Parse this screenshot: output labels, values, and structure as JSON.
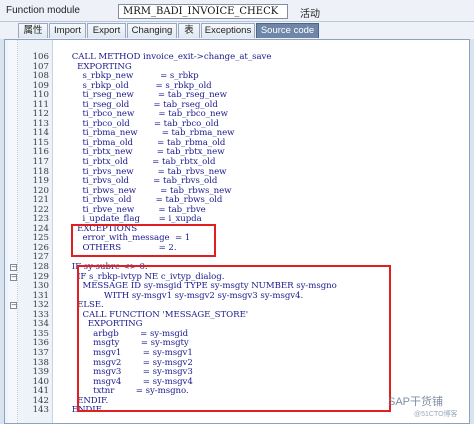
{
  "header": {
    "function_module_label": "Function module",
    "function_module_value": "MRM_BADI_INVOICE_CHECK",
    "status": "活动"
  },
  "tabs": [
    {
      "label": "属性"
    },
    {
      "label": "Import"
    },
    {
      "label": "Export"
    },
    {
      "label": "Changing"
    },
    {
      "label": "表"
    },
    {
      "label": "Exceptions"
    },
    {
      "label": "Source code",
      "active": true
    }
  ],
  "code": [
    {
      "n": "106",
      "t": "    CALL METHOD invoice_exit->change_at_save"
    },
    {
      "n": "107",
      "t": "      EXPORTING"
    },
    {
      "n": "108",
      "t": "        s_rbkp_new          = s_rbkp"
    },
    {
      "n": "109",
      "t": "        s_rbkp_old          = s_rbkp_old"
    },
    {
      "n": "110",
      "t": "        ti_rseg_new         = tab_rseg_new"
    },
    {
      "n": "111",
      "t": "        ti_rseg_old         = tab_rseg_old"
    },
    {
      "n": "112",
      "t": "        ti_rbco_new         = tab_rbco_new"
    },
    {
      "n": "113",
      "t": "        ti_rbco_old         = tab_rbco_old"
    },
    {
      "n": "114",
      "t": "        ti_rbma_new         = tab_rbma_new"
    },
    {
      "n": "115",
      "t": "        ti_rbma_old         = tab_rbma_old"
    },
    {
      "n": "116",
      "t": "        ti_rbtx_new         = tab_rbtx_new"
    },
    {
      "n": "117",
      "t": "        ti_rbtx_old         = tab_rbtx_old"
    },
    {
      "n": "118",
      "t": "        ti_rbvs_new         = tab_rbvs_new"
    },
    {
      "n": "119",
      "t": "        ti_rbvs_old         = tab_rbvs_old"
    },
    {
      "n": "120",
      "t": "        ti_rbws_new         = tab_rbws_new"
    },
    {
      "n": "121",
      "t": "        ti_rbws_old         = tab_rbws_old"
    },
    {
      "n": "122",
      "t": "        ti_rbve_new         = tab_rbve"
    },
    {
      "n": "123",
      "t": "        i_update_flag       = i_xupda"
    },
    {
      "n": "124",
      "t": "      EXCEPTIONS"
    },
    {
      "n": "125",
      "t": "        error_with_message  = 1"
    },
    {
      "n": "126",
      "t": "        OTHERS              = 2."
    },
    {
      "n": "127",
      "t": ""
    },
    {
      "n": "128",
      "t": "    IF sy-subrc <> 0."
    },
    {
      "n": "129",
      "t": "      IF s_rbkp-ivtyp NE c_ivtyp_dialog."
    },
    {
      "n": "130",
      "t": "        MESSAGE ID sy-msgid TYPE sy-msgty NUMBER sy-msgno"
    },
    {
      "n": "131",
      "t": "                WITH sy-msgv1 sy-msgv2 sy-msgv3 sy-msgv4."
    },
    {
      "n": "132",
      "t": "      ELSE."
    },
    {
      "n": "133",
      "t": "        CALL FUNCTION 'MESSAGE_STORE'"
    },
    {
      "n": "134",
      "t": "          EXPORTING"
    },
    {
      "n": "135",
      "t": "            arbgb        = sy-msgid"
    },
    {
      "n": "136",
      "t": "            msgty        = sy-msgty"
    },
    {
      "n": "137",
      "t": "            msgv1        = sy-msgv1"
    },
    {
      "n": "138",
      "t": "            msgv2        = sy-msgv2"
    },
    {
      "n": "139",
      "t": "            msgv3        = sy-msgv3"
    },
    {
      "n": "140",
      "t": "            msgv4        = sy-msgv4"
    },
    {
      "n": "141",
      "t": "            txtnr        = sy-msgno."
    },
    {
      "n": "142",
      "t": "      ENDIF."
    },
    {
      "n": "143",
      "t": "    ENDIF."
    }
  ],
  "watermark": {
    "main": "SAP干货铺",
    "sub": "@51CTO博客"
  },
  "colors": {
    "highlight": "#e02020",
    "active_tab": "#6f86a8",
    "code_text": "#1a1a8c"
  }
}
